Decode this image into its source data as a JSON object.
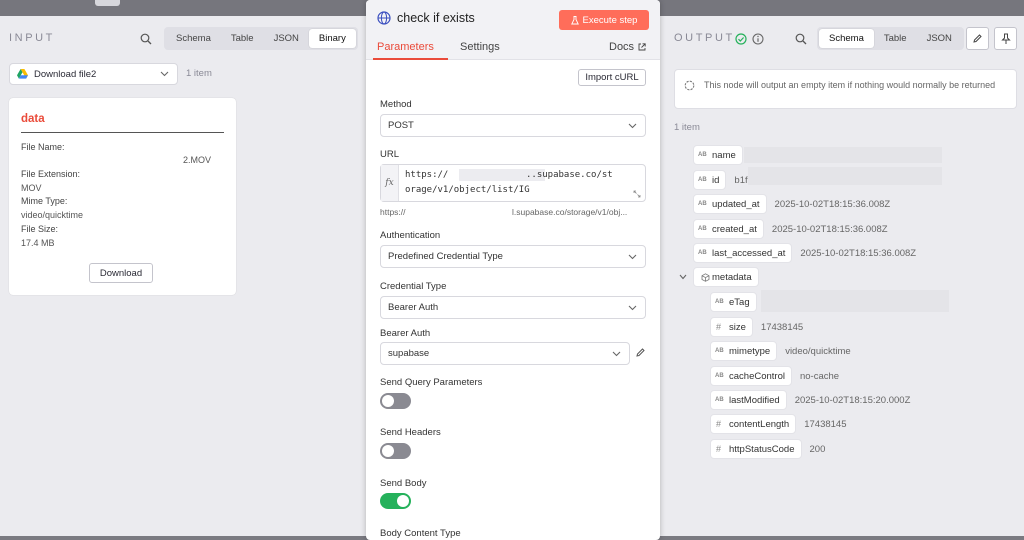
{
  "input": {
    "title": "INPUT",
    "tabs": [
      "Schema",
      "Table",
      "JSON",
      "Binary"
    ],
    "active_tab": "Binary",
    "source_select": "Download file2",
    "item_count": "1 item",
    "binary": {
      "name": "data",
      "file_name_label": "File Name:",
      "file_name_value": "2.MOV",
      "extension_label": "File Extension:",
      "extension_value": "MOV",
      "mime_label": "Mime Type:",
      "mime_value": "video/quicktime",
      "size_label": "File Size:",
      "size_value": "17.4 MB",
      "download_label": "Download"
    }
  },
  "node": {
    "title": "check if exists",
    "execute_label": "Execute step",
    "tabs": [
      "Parameters",
      "Settings"
    ],
    "docs_label": "Docs",
    "import_curl_label": "Import cURL",
    "method_label": "Method",
    "method_value": "POST",
    "url_label": "URL",
    "fx_label": "fx",
    "url_line1_start": "https://",
    "url_line1_end": "..supabase.co/st",
    "url_line2": "orage/v1/object/list/IG",
    "url_preview_start": "https://",
    "url_preview_end": "l.supabase.co/storage/v1/obj...",
    "auth_label": "Authentication",
    "auth_value": "Predefined Credential Type",
    "cred_type_label": "Credential Type",
    "cred_type_value": "Bearer Auth",
    "bearer_label": "Bearer Auth",
    "bearer_value": "supabase",
    "send_query_label": "Send Query Parameters",
    "send_query_on": false,
    "send_headers_label": "Send Headers",
    "send_headers_on": false,
    "send_body_label": "Send Body",
    "send_body_on": true,
    "body_type_label": "Body Content Type"
  },
  "output": {
    "title": "OUTPUT",
    "tabs": [
      "Schema",
      "Table",
      "JSON"
    ],
    "active_tab": "Schema",
    "notice": "This node will output an empty item if nothing would normally be returned",
    "item_count": "1 item",
    "fields": [
      {
        "key": "name",
        "type": "string",
        "value": ""
      },
      {
        "key": "id",
        "type": "string",
        "value": "b1f"
      },
      {
        "key": "updated_at",
        "type": "string",
        "value": "2025-10-02T18:15:36.008Z"
      },
      {
        "key": "created_at",
        "type": "string",
        "value": "2025-10-02T18:15:36.008Z"
      },
      {
        "key": "last_accessed_at",
        "type": "string",
        "value": "2025-10-02T18:15:36.008Z"
      }
    ],
    "metadata_key": "metadata",
    "metadata": [
      {
        "key": "eTag",
        "type": "string",
        "value": ""
      },
      {
        "key": "size",
        "type": "number",
        "value": "17438145"
      },
      {
        "key": "mimetype",
        "type": "string",
        "value": "video/quicktime"
      },
      {
        "key": "cacheControl",
        "type": "string",
        "value": "no-cache"
      },
      {
        "key": "lastModified",
        "type": "string",
        "value": "2025-10-02T18:15:20.000Z"
      },
      {
        "key": "contentLength",
        "type": "number",
        "value": "17438145"
      },
      {
        "key": "httpStatusCode",
        "type": "number",
        "value": "200"
      }
    ]
  },
  "colors": {
    "accent": "#ff6d5a",
    "success": "#25b15b",
    "primary_link": "#ea4b3a"
  }
}
